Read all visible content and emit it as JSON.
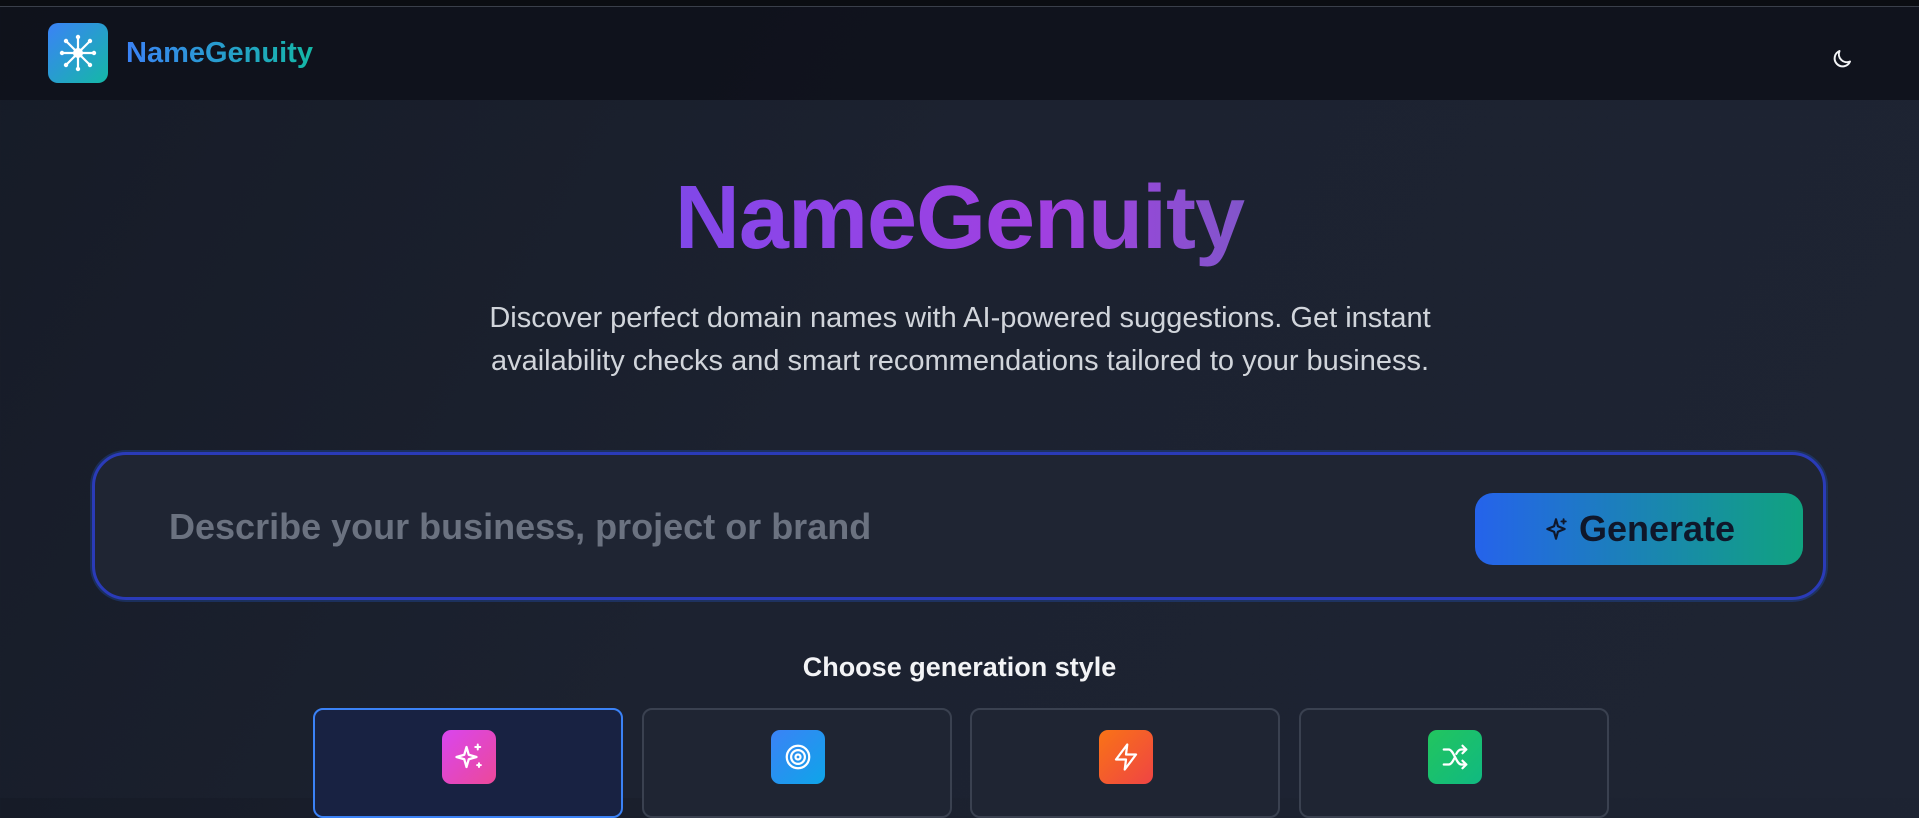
{
  "header": {
    "brand": "NameGenuity",
    "logo_icon": "network-hub-icon",
    "theme_toggle_icon": "moon-icon"
  },
  "hero": {
    "title": "NameGenuity",
    "subtitle_line1": "Discover perfect domain names with AI-powered suggestions. Get instant",
    "subtitle_line2": "availability checks and smart recommendations tailored to your business."
  },
  "search": {
    "value": "",
    "placeholder": "Describe your business, project or brand",
    "generate_label": "Generate",
    "generate_icon": "sparkle-icon"
  },
  "styles": {
    "heading": "Choose generation style",
    "options": [
      {
        "icon": "sparkles-icon",
        "color_from": "#d946ef",
        "color_to": "#ec4899",
        "selected": true
      },
      {
        "icon": "target-icon",
        "color_from": "#3b82f6",
        "color_to": "#0ea5e9",
        "selected": false
      },
      {
        "icon": "lightning-icon",
        "color_from": "#f97316",
        "color_to": "#ef4444",
        "selected": false
      },
      {
        "icon": "shuffle-icon",
        "color_from": "#22c55e",
        "color_to": "#10b981",
        "selected": false
      }
    ]
  },
  "colors": {
    "accent_blue": "#3b82f6",
    "accent_teal": "#14b8a6",
    "background": "#1c2230"
  }
}
